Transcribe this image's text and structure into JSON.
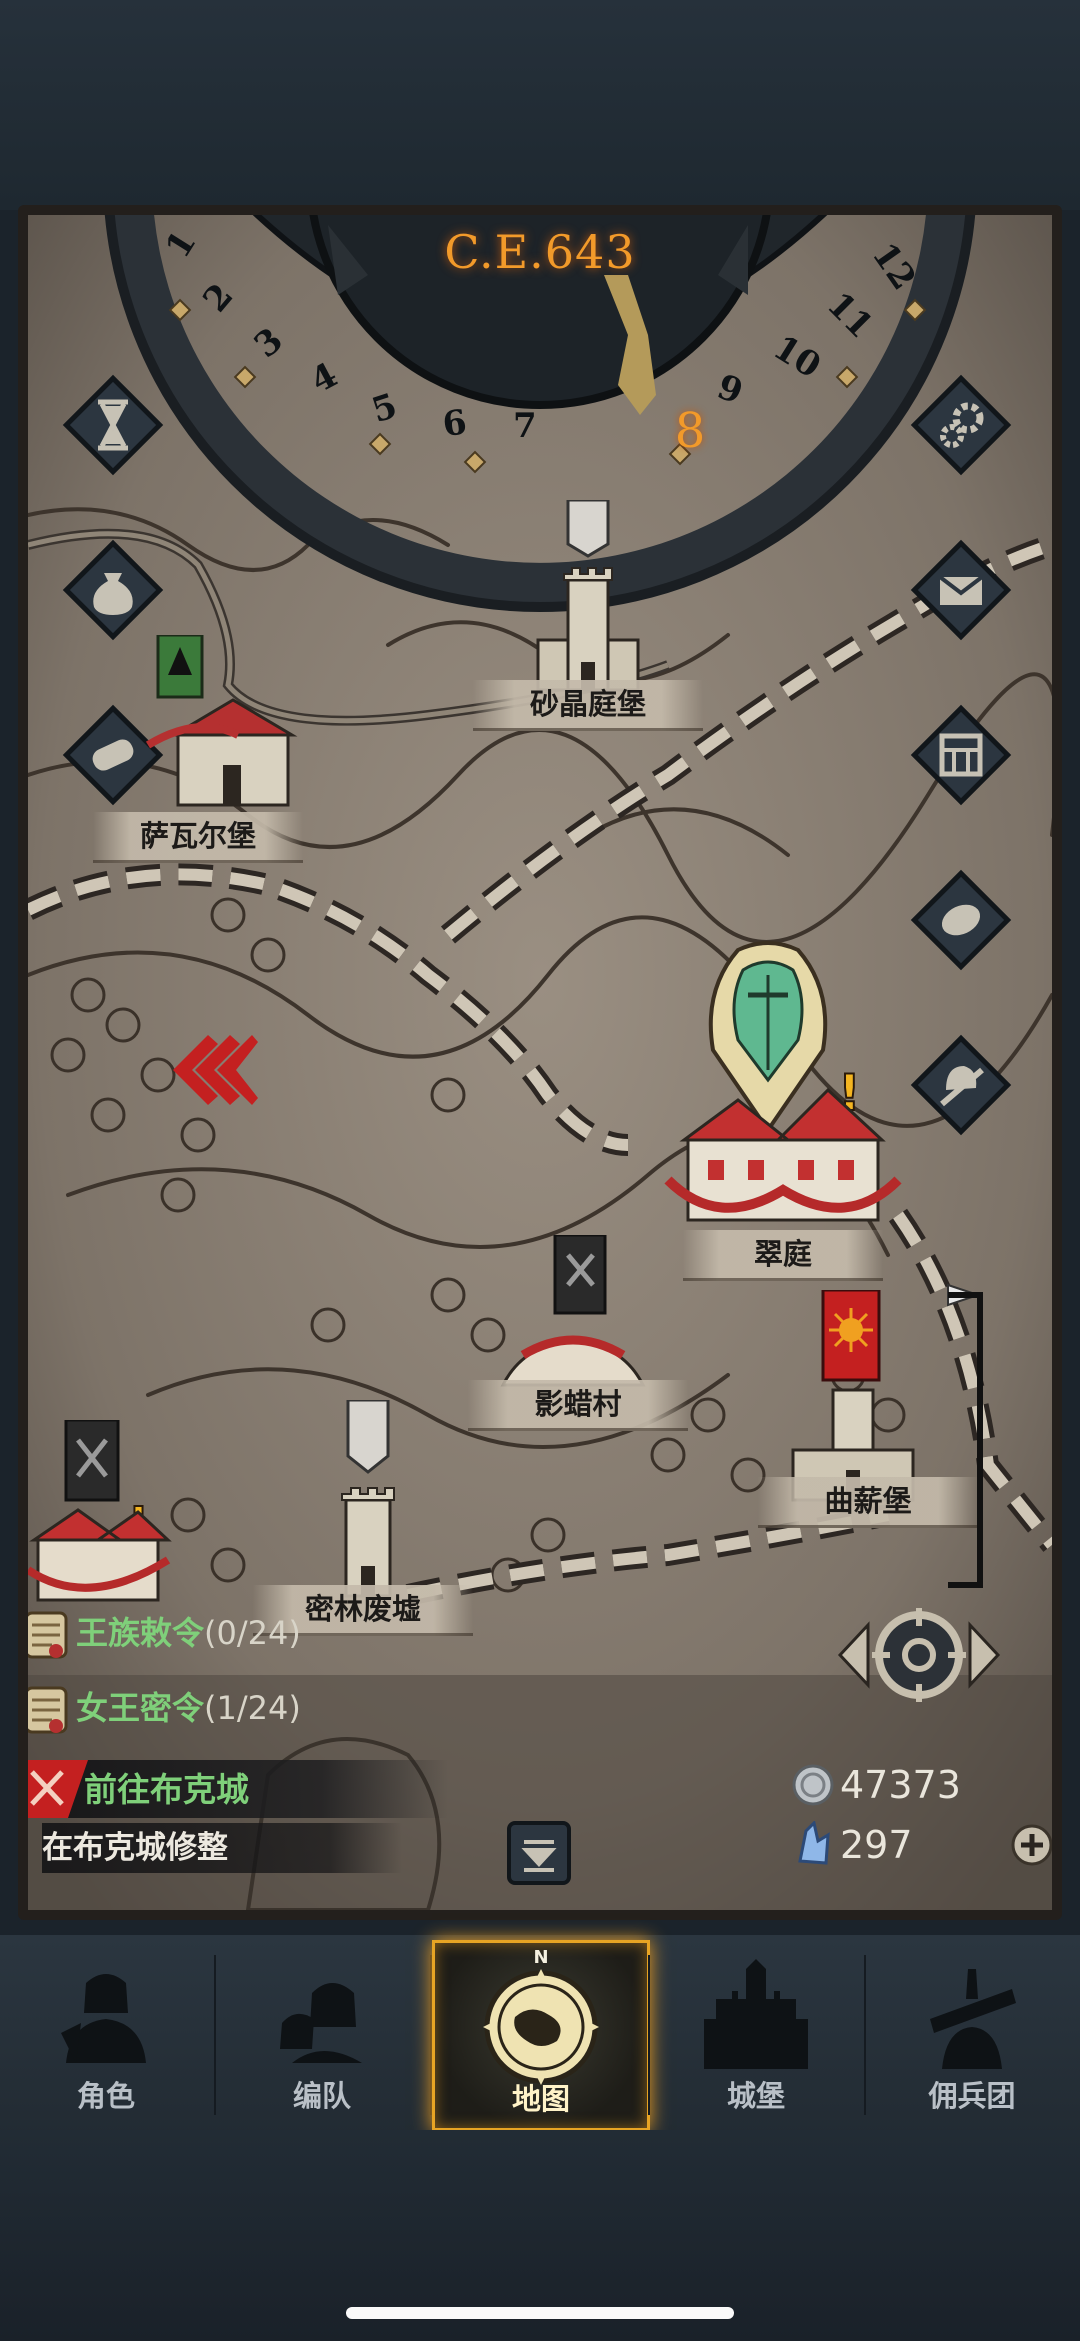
{
  "calendar": {
    "year": "C.E.643",
    "current_month": "8",
    "months": [
      "1",
      "2",
      "3",
      "4",
      "5",
      "6",
      "7",
      "8",
      "9",
      "10",
      "11",
      "12"
    ]
  },
  "locations": {
    "shajing": "砂晶庭堡",
    "sawaer": "萨瓦尔堡",
    "cuiting": "翠庭",
    "yingla": "影蜡村",
    "quxin": "曲薪堡",
    "milin": "密林废墟"
  },
  "quests": [
    {
      "name": "王族敕令",
      "count": "(0/24)"
    },
    {
      "name": "女王密令",
      "count": "(1/24)"
    }
  ],
  "task": {
    "title": "前往布克城",
    "subtitle": "在布克城修整"
  },
  "resources": {
    "silver": "47373",
    "crystal": "297"
  },
  "tabs": [
    {
      "label": "角色"
    },
    {
      "label": "编队"
    },
    {
      "label": "地图",
      "compass_n": "N"
    },
    {
      "label": "城堡"
    },
    {
      "label": "佣兵团"
    }
  ],
  "colors": {
    "accent_orange": "#f29a2a",
    "quest_green": "#7fd07a",
    "parchment": "#8a7f72",
    "active_tab_border": "#e7a424"
  }
}
